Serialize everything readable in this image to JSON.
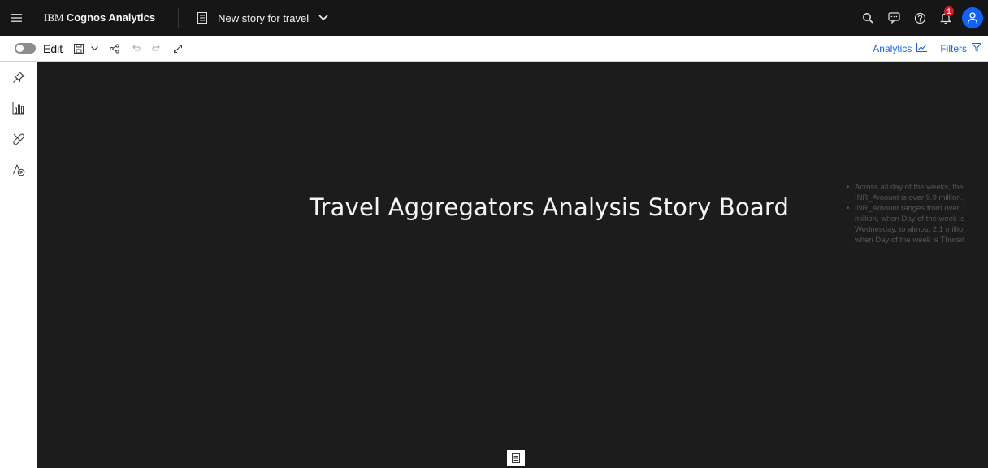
{
  "header": {
    "menu_icon": "hamburger-icon",
    "brand_prefix": "IBM",
    "brand_name": "Cognos Analytics",
    "story_icon": "story-icon",
    "story_title": "New story for travel",
    "notification_count": "1"
  },
  "toolbar": {
    "edit_label": "Edit",
    "analytics_label": "Analytics",
    "filters_label": "Filters"
  },
  "canvas": {
    "title": "Travel Aggregators Analysis Story Board",
    "insights": [
      [
        "Across all day of the weeks, the",
        "INR_Amount is over 9.9 million."
      ],
      [
        "INR_Amount ranges from over 1",
        "million, when Day of the week is",
        "Wednesday, to almost 2.1 millio",
        "when Day of the week is Thursd"
      ]
    ]
  },
  "colors": {
    "header_bg": "#161616",
    "canvas_bg": "#1c1c1c",
    "accent": "#0f62fe",
    "badge": "#da1e28"
  }
}
